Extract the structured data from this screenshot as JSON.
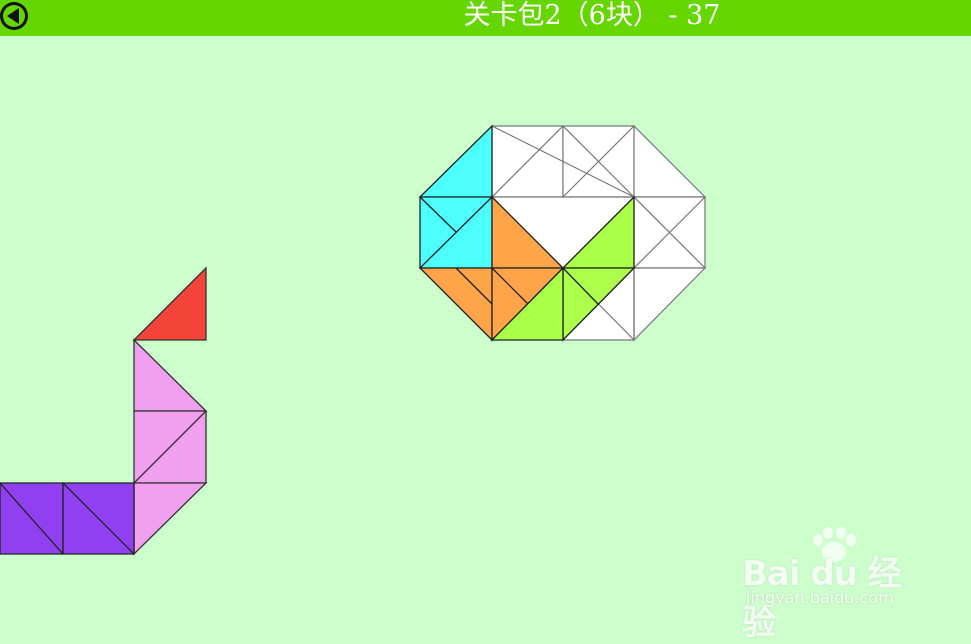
{
  "header": {
    "title": "关卡包2（6块） - 37",
    "back_icon": "back-arrow-icon",
    "bar_color": "#66d600"
  },
  "board": {
    "background_color": "#ccffcc",
    "target_shape": "octagon",
    "empty_cell_color": "#ffffff"
  },
  "pieces": [
    {
      "name": "cyan-piece",
      "color": "#44ffff",
      "placed": true
    },
    {
      "name": "orange-piece",
      "color": "#ffa040",
      "placed": true
    },
    {
      "name": "lime-piece",
      "color": "#a8ff40",
      "placed": true
    },
    {
      "name": "red-piece",
      "color": "#f4443a",
      "placed": false
    },
    {
      "name": "pink-piece",
      "color": "#f0a0ee",
      "placed": false
    },
    {
      "name": "purple-piece",
      "color": "#9040f0",
      "placed": false
    }
  ],
  "watermark": {
    "brand": "Bai du 经验",
    "url": "jingyan.baidu.com"
  }
}
